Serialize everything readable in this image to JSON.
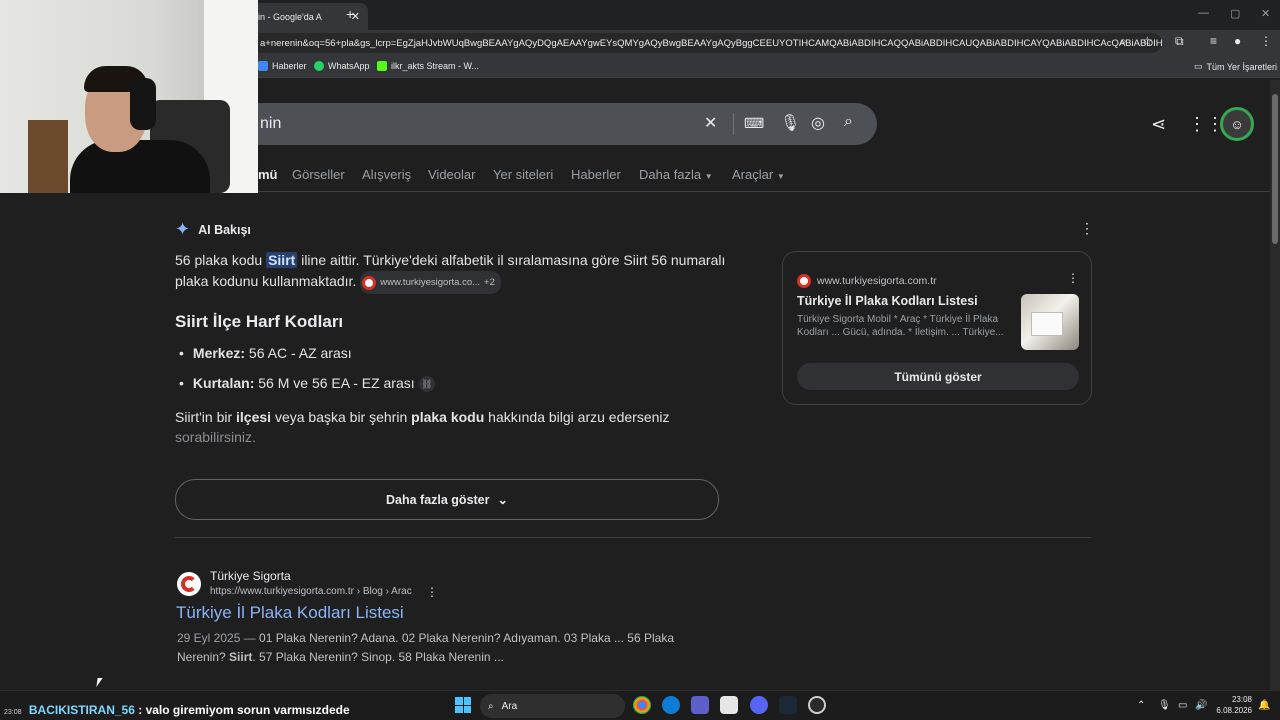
{
  "browser": {
    "tab_title": "in - Google'da A",
    "url": "a+nerenin&oq=56+pla&gs_lcrp=EgZjaHJvbWUqBwgBEAAYgAQyDQgAEAAYgwEYsQMYgAQyBwgBEAAYgAQyBggCEEUYOTIHCAMQABiABDIHCAQQABiABDIHCAUQABiABDIHCAYQABiABDIHCAcQABiABDIHC...",
    "bookmarks": [
      {
        "label": "Haberler",
        "color": "#4285f4"
      },
      {
        "label": "WhatsApp",
        "color": "#25d366"
      },
      {
        "label": "ilkr_akts Stream - W...",
        "color": "#53fc18"
      }
    ],
    "all_bookmarks_label": "Tüm Yer İşaretleri"
  },
  "search": {
    "query": "nin",
    "tabs": [
      {
        "label": "mü",
        "active": true
      },
      {
        "label": "Görseller"
      },
      {
        "label": "Alışveriş"
      },
      {
        "label": "Videolar"
      },
      {
        "label": "Yer siteleri"
      },
      {
        "label": "Haberler"
      },
      {
        "label": "Daha fazla"
      },
      {
        "label": "Araçlar"
      }
    ]
  },
  "ai": {
    "title": "AI Bakışı",
    "p1_a": "56 plaka kodu ",
    "p1_hl": "Siirt",
    "p1_b": " iline aittir. Türkiye'deki alfabetik il sıralamasına göre Siirt 56 numaralı plaka kodunu kullanmaktadır.",
    "chip_site": "www.turkiyesigorta.co...",
    "chip_more": "+2",
    "h2": "Siirt İlçe Harf Kodları",
    "bullets": [
      {
        "bold": "Merkez:",
        "text": " 56 AC - AZ arası"
      },
      {
        "bold": "Kurtalan:",
        "text": " 56 M ve 56 EA - EZ arası"
      }
    ],
    "para_1": "Siirt'in bir ",
    "para_b1": "ilçesi",
    "para_2": " veya başka bir şehrin ",
    "para_b2": "plaka kodu",
    "para_3": " hakkında bilgi arzu ederseniz",
    "para_fade": "sorabilirsiniz.",
    "more_label": "Daha fazla göster"
  },
  "card": {
    "site": "www.turkiyesigorta.com.tr",
    "title": "Türkiye İl Plaka Kodları Listesi",
    "desc": "Türkiye Sigorta Mobil * Araç * Türkiye İl Plaka Kodları ... Gücü, adında. * İletişim. ... Türkiye...",
    "button": "Tümünü göster"
  },
  "result": {
    "site": "Türkiye Sigorta",
    "url": "https://www.turkiyesigorta.com.tr › Blog › Arac",
    "title": "Türkiye İl Plaka Kodları Listesi",
    "date": "29 Eyl 2025 —",
    "snippet_1": " 01 Plaka Nerenin? Adana. 02 Plaka Nerenin? Adıyaman. 03 Plaka ... 56 Plaka Nerenin?",
    "snippet_bold": "Siirt",
    "snippet_2": ". 57 Plaka Nerenin? Sinop. 58 Plaka Nerenin ..."
  },
  "stream_chat": {
    "time": "23:08",
    "user": "BACIKISTIRAN_56",
    "message": " : valo giremiyom sorun varmısızdede"
  },
  "taskbar": {
    "search_label": "Ara",
    "time": "23:08",
    "date": "6.08.2026"
  }
}
